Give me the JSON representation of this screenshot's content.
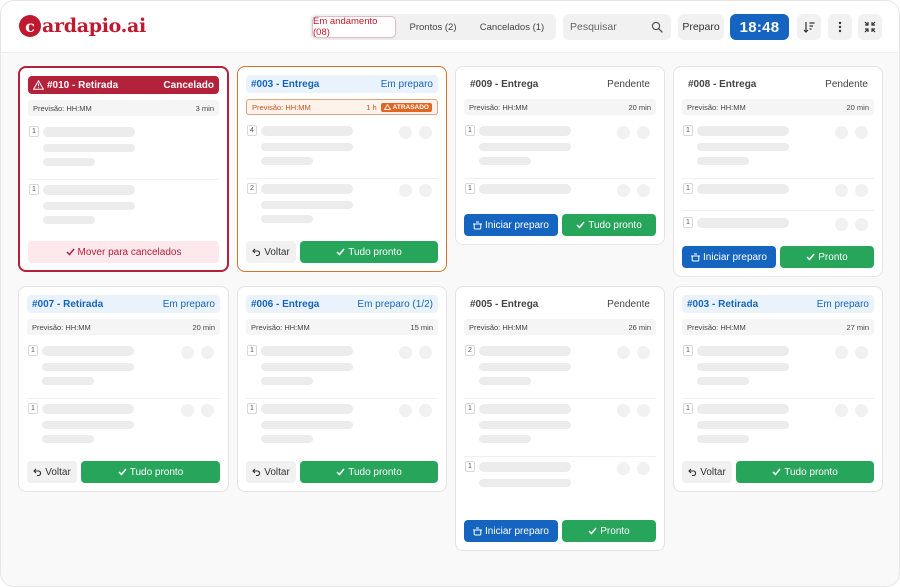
{
  "app": {
    "logo_mark": "c",
    "logo_text": "ardapio.ai"
  },
  "tabs": [
    {
      "label": "Em andamento (08)",
      "active": true
    },
    {
      "label": "Prontos (2)",
      "active": false
    },
    {
      "label": "Cancelados (1)",
      "active": false
    }
  ],
  "search": {
    "placeholder": "Pesquisar",
    "value": ""
  },
  "toolbar": {
    "preparo_label": "Preparo",
    "clock": "18:48"
  },
  "icons": {
    "search": "search-icon",
    "sort": "sort-icon",
    "more": "more-vertical-icon",
    "collapse": "collapse-icon",
    "warning": "warning-icon",
    "check": "check-icon",
    "undo": "undo-icon",
    "pot": "cooking-pot-icon"
  },
  "colors": {
    "brand": "#c0182e",
    "primary": "#1565c0",
    "success": "#27a55a",
    "late": "#e2661f",
    "cancel": "#b3213a"
  },
  "labels": {
    "forecast": "Previsão: HH:MM",
    "voltar": "Voltar",
    "tudo_pronto": "Tudo pronto",
    "pronto": "Pronto",
    "iniciar_preparo": "Iniciar preparo",
    "mover_cancelados": "Mover para cancelados",
    "atrasado": "ATRASADO"
  },
  "orders": [
    {
      "id": "#010 - Retirada",
      "status": "Cancelado",
      "time": "3 min",
      "quantities": [
        "1",
        "1"
      ]
    },
    {
      "id": "#003 - Entrega",
      "status": "Em preparo",
      "time": "1 h",
      "quantities": [
        "4",
        "2"
      ]
    },
    {
      "id": "#009 - Entrega",
      "status": "Pendente",
      "time": "20 min",
      "quantities": [
        "1",
        "1"
      ]
    },
    {
      "id": "#008 - Entrega",
      "status": "Pendente",
      "time": "20 min",
      "quantities": [
        "1",
        "1",
        "1"
      ]
    },
    {
      "id": "#007 - Retirada",
      "status": "Em preparo",
      "time": "20 min",
      "quantities": [
        "1",
        "1"
      ]
    },
    {
      "id": "#006 - Entrega",
      "status": "Em preparo (1/2)",
      "time": "15 min",
      "quantities": [
        "1",
        "1"
      ]
    },
    {
      "id": "#005 - Entrega",
      "status": "Pendente",
      "time": "26 min",
      "quantities": [
        "2",
        "1",
        "1"
      ]
    },
    {
      "id": "#003 - Retirada",
      "status": "Em preparo",
      "time": "27 min",
      "quantities": [
        "1",
        "1"
      ]
    }
  ]
}
